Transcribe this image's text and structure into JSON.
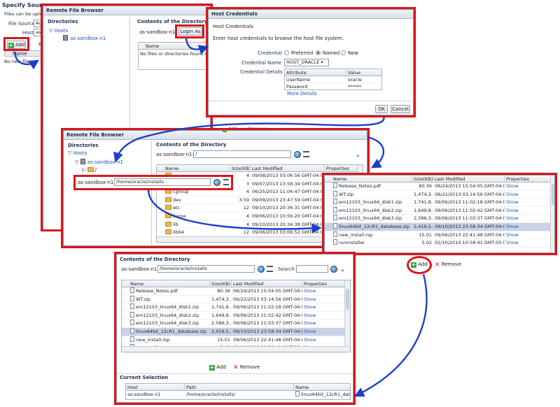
{
  "bg": {
    "title": "Specify Source",
    "subtitle": "Files can be uploa",
    "file_source_label": "File Source",
    "file_source_value": "Ag",
    "host_label": "Host",
    "host_value": "as",
    "add_label": "Add",
    "remove_label": "R",
    "name_col": "Name",
    "no_files": "No new files"
  },
  "browser1": {
    "title": "Remote File Browser",
    "directories_title": "Directories",
    "tree": {
      "hosts": "Hosts",
      "host": "as-sandbox-n1"
    },
    "contents_title": "Contents of the Directory",
    "host_label": "as-sandbox-n1",
    "login_as": "Login As",
    "name_col": "Name",
    "empty": "No files or directories found or"
  },
  "credentials": {
    "title": "Host Credentials",
    "section": "Host Credentials",
    "instruction": "Enter host credentials to browse the host file system.",
    "credential_label": "Credential",
    "options": [
      "Preferred",
      "Named",
      "New"
    ],
    "selected": "Named",
    "credential_name_label": "Credential Name",
    "credential_name_value": "HOST_ORACLE",
    "details_label": "Credential Details",
    "headers": [
      "Attribute",
      "Value"
    ],
    "rows": [
      {
        "attr": "UserName",
        "value": "oracle"
      },
      {
        "attr": "Password",
        "value": "******"
      }
    ],
    "more_details": "More Details",
    "ok": "OK",
    "cancel": "Cancel"
  },
  "browser2": {
    "title": "Remote File Browser",
    "directories_title": "Directories",
    "tree": {
      "hosts": "Hosts",
      "host": "as-sandbox-n1",
      "root": "/"
    },
    "contents_title": "Contents of the Directory",
    "path_host": "as-sandbox-n1:",
    "path_value": "/",
    "path_callout_host": "as-sandbox-n1:",
    "path_callout_value": "/home/oracle/installs",
    "headers": [
      "Name",
      "Size(KB)",
      "Last Modified",
      "Properties"
    ],
    "rows": [
      {
        "name": "",
        "size": "4",
        "modified": "09/08/2013 03:06:56 GMT-04:00"
      },
      {
        "name": "",
        "size": "3",
        "modified": "09/07/2013 13:58:34 GMT-04:00"
      },
      {
        "name": "cgroup",
        "size": "4",
        "modified": "06/25/2013 11:04:47 GMT-04:00"
      },
      {
        "name": "dev",
        "size": "3.59",
        "modified": "09/09/2013 23:47:59 GMT-04:00"
      },
      {
        "name": "etc",
        "size": "12",
        "modified": "09/10/2013 20:36:31 GMT-04:00"
      },
      {
        "name": "home",
        "size": "4",
        "modified": "09/06/2013 10:56:20 GMT-04:00"
      },
      {
        "name": "lib",
        "size": "4",
        "modified": "09/10/2013 20:34:38 GMT-04:00"
      },
      {
        "name": "lib64",
        "size": "12",
        "modified": "09/06/2013 03:06:52 GMT-04:00"
      }
    ],
    "footer_add": "Add",
    "footer_remove": "Remove"
  },
  "files_popup": {
    "headers": [
      "Name",
      "Size(KB)",
      "Last Modified",
      "Properties"
    ],
    "rows": [
      {
        "name": "Release_Notes.pdf",
        "size": "80.36",
        "modified": "06/24/2013 15:54:05 GMT-04:00",
        "prop": "Show"
      },
      {
        "name": "WT.zip",
        "size": "1,474,3...",
        "modified": "06/22/2013 03:14:56 GMT-04:00",
        "prop": "Show"
      },
      {
        "name": "em12103_linux64_disk1.zip",
        "size": "1,741,8...",
        "modified": "09/06/2013 11:02:18 GMT-04:00",
        "prop": "Show"
      },
      {
        "name": "em12103_linux64_disk2.zip",
        "size": "1,649,8...",
        "modified": "09/06/2013 11:02:42 GMT-04:00",
        "prop": "Show"
      },
      {
        "name": "em12103_linux64_disk3.zip",
        "size": "2,586,3...",
        "modified": "09/06/2013 11:03:37 GMT-04:00",
        "prop": "Show"
      },
      {
        "name": "linux64bit_12cR1_database.zip",
        "size": "2,419,5...",
        "modified": "09/10/2013 23:58:34 GMT-04:00",
        "prop": "Show"
      },
      {
        "name": "new_install.rsp",
        "size": "15.01",
        "modified": "09/06/2013 22:41:48 GMT-04:00",
        "prop": "Show"
      },
      {
        "name": "runInstaller",
        "size": "5.02",
        "modified": "02/10/2010 10:58:41 GMT-05:00",
        "prop": "Show"
      }
    ],
    "selected_index": 5,
    "add": "Add",
    "remove": "Remove"
  },
  "final": {
    "contents_title": "Contents of the Directory",
    "path_host": "as-sandbox-n1:",
    "path_value": "/home/oracle/installs",
    "search_label": "Search",
    "headers": [
      "Name",
      "Size(KB)",
      "Last Modified",
      "Properties"
    ],
    "rows": [
      {
        "name": "Release_Notes.pdf",
        "size": "80.36",
        "modified": "06/24/2013 15:54:05 GMT-04:00",
        "prop": "Show"
      },
      {
        "name": "WT.zip",
        "size": "1,474,3...",
        "modified": "06/22/2013 03:14:56 GMT-04:00",
        "prop": "Show"
      },
      {
        "name": "em12103_linux64_disk1.zip",
        "size": "1,741,8...",
        "modified": "09/06/2013 11:02:18 GMT-04:00",
        "prop": "Show"
      },
      {
        "name": "em12103_linux64_disk2.zip",
        "size": "1,649,8...",
        "modified": "09/06/2013 11:02:42 GMT-04:00",
        "prop": "Show"
      },
      {
        "name": "em12103_linux64_disk3.zip",
        "size": "2,586,3...",
        "modified": "09/06/2013 11:03:37 GMT-04:00",
        "prop": "Show"
      },
      {
        "name": "linux64bit_12cR1_database.zip",
        "size": "2,419,5...",
        "modified": "09/10/2013 23:58:34 GMT-04:00",
        "prop": "Show"
      },
      {
        "name": "new_install.rsp",
        "size": "15.01",
        "modified": "09/06/2013 22:41:48 GMT-04:00",
        "prop": "Show"
      },
      {
        "name": "runInstaller",
        "size": "5.02",
        "modified": "02/10/2010 10:58:41 GMT-05:00",
        "prop": "Show"
      }
    ],
    "selected_index": 5,
    "add": "Add",
    "remove": "Remove",
    "selection_title": "Current Selection",
    "selection_headers": [
      "Host",
      "Path",
      "Name"
    ],
    "selection_row": {
      "host": "as-sandbox-n1",
      "path": "/home/oracle/installs/",
      "name": "linux64bit_12cR1_data"
    }
  },
  "colors": {
    "callout": "#d8161d",
    "arrow": "#1b3fc9",
    "link": "#1a55b5",
    "selected_row": "#c8d2e6"
  }
}
